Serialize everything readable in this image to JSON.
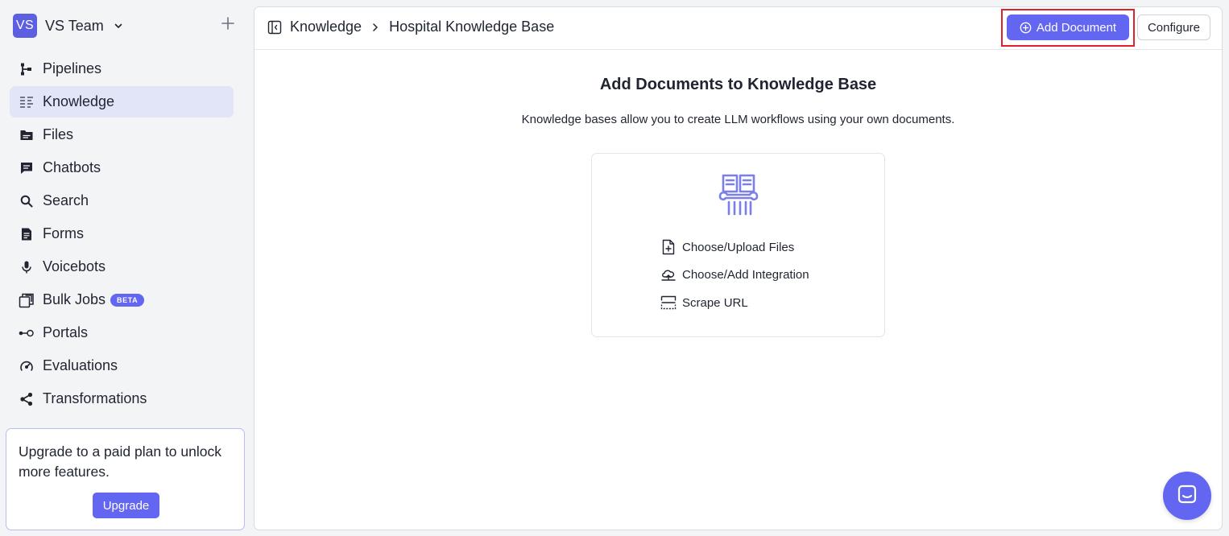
{
  "team": {
    "avatar_initials": "VS",
    "name": "VS Team"
  },
  "sidebar": {
    "items": [
      {
        "label": "Pipelines",
        "icon": "pipeline-icon",
        "active": false
      },
      {
        "label": "Knowledge",
        "icon": "knowledge-icon",
        "active": true
      },
      {
        "label": "Files",
        "icon": "folder-icon",
        "active": false
      },
      {
        "label": "Chatbots",
        "icon": "chat-icon",
        "active": false
      },
      {
        "label": "Search",
        "icon": "search-icon",
        "active": false
      },
      {
        "label": "Forms",
        "icon": "form-icon",
        "active": false
      },
      {
        "label": "Voicebots",
        "icon": "microphone-icon",
        "active": false
      },
      {
        "label": "Bulk Jobs",
        "icon": "copy-icon",
        "active": false,
        "badge": "BETA"
      },
      {
        "label": "Portals",
        "icon": "portal-icon",
        "active": false
      },
      {
        "label": "Evaluations",
        "icon": "gauge-icon",
        "active": false
      },
      {
        "label": "Transformations",
        "icon": "share-icon",
        "active": false
      }
    ]
  },
  "upgrade": {
    "text": "Upgrade to a paid plan to unlock more features.",
    "button_label": "Upgrade"
  },
  "header": {
    "breadcrumb": [
      "Knowledge",
      "Hospital Knowledge Base"
    ],
    "add_document_label": "Add Document",
    "configure_label": "Configure"
  },
  "main": {
    "title": "Add Documents to Knowledge Base",
    "subtitle": "Knowledge bases allow you to create LLM workflows using your own documents.",
    "options": [
      {
        "label": "Choose/Upload Files",
        "icon": "file-plus-icon"
      },
      {
        "label": "Choose/Add Integration",
        "icon": "cloud-upload-icon"
      },
      {
        "label": "Scrape URL",
        "icon": "scrape-icon"
      }
    ]
  },
  "colors": {
    "accent": "#6366f1",
    "active_nav_bg": "#e2e4f7",
    "highlight_border": "#e0202a"
  }
}
